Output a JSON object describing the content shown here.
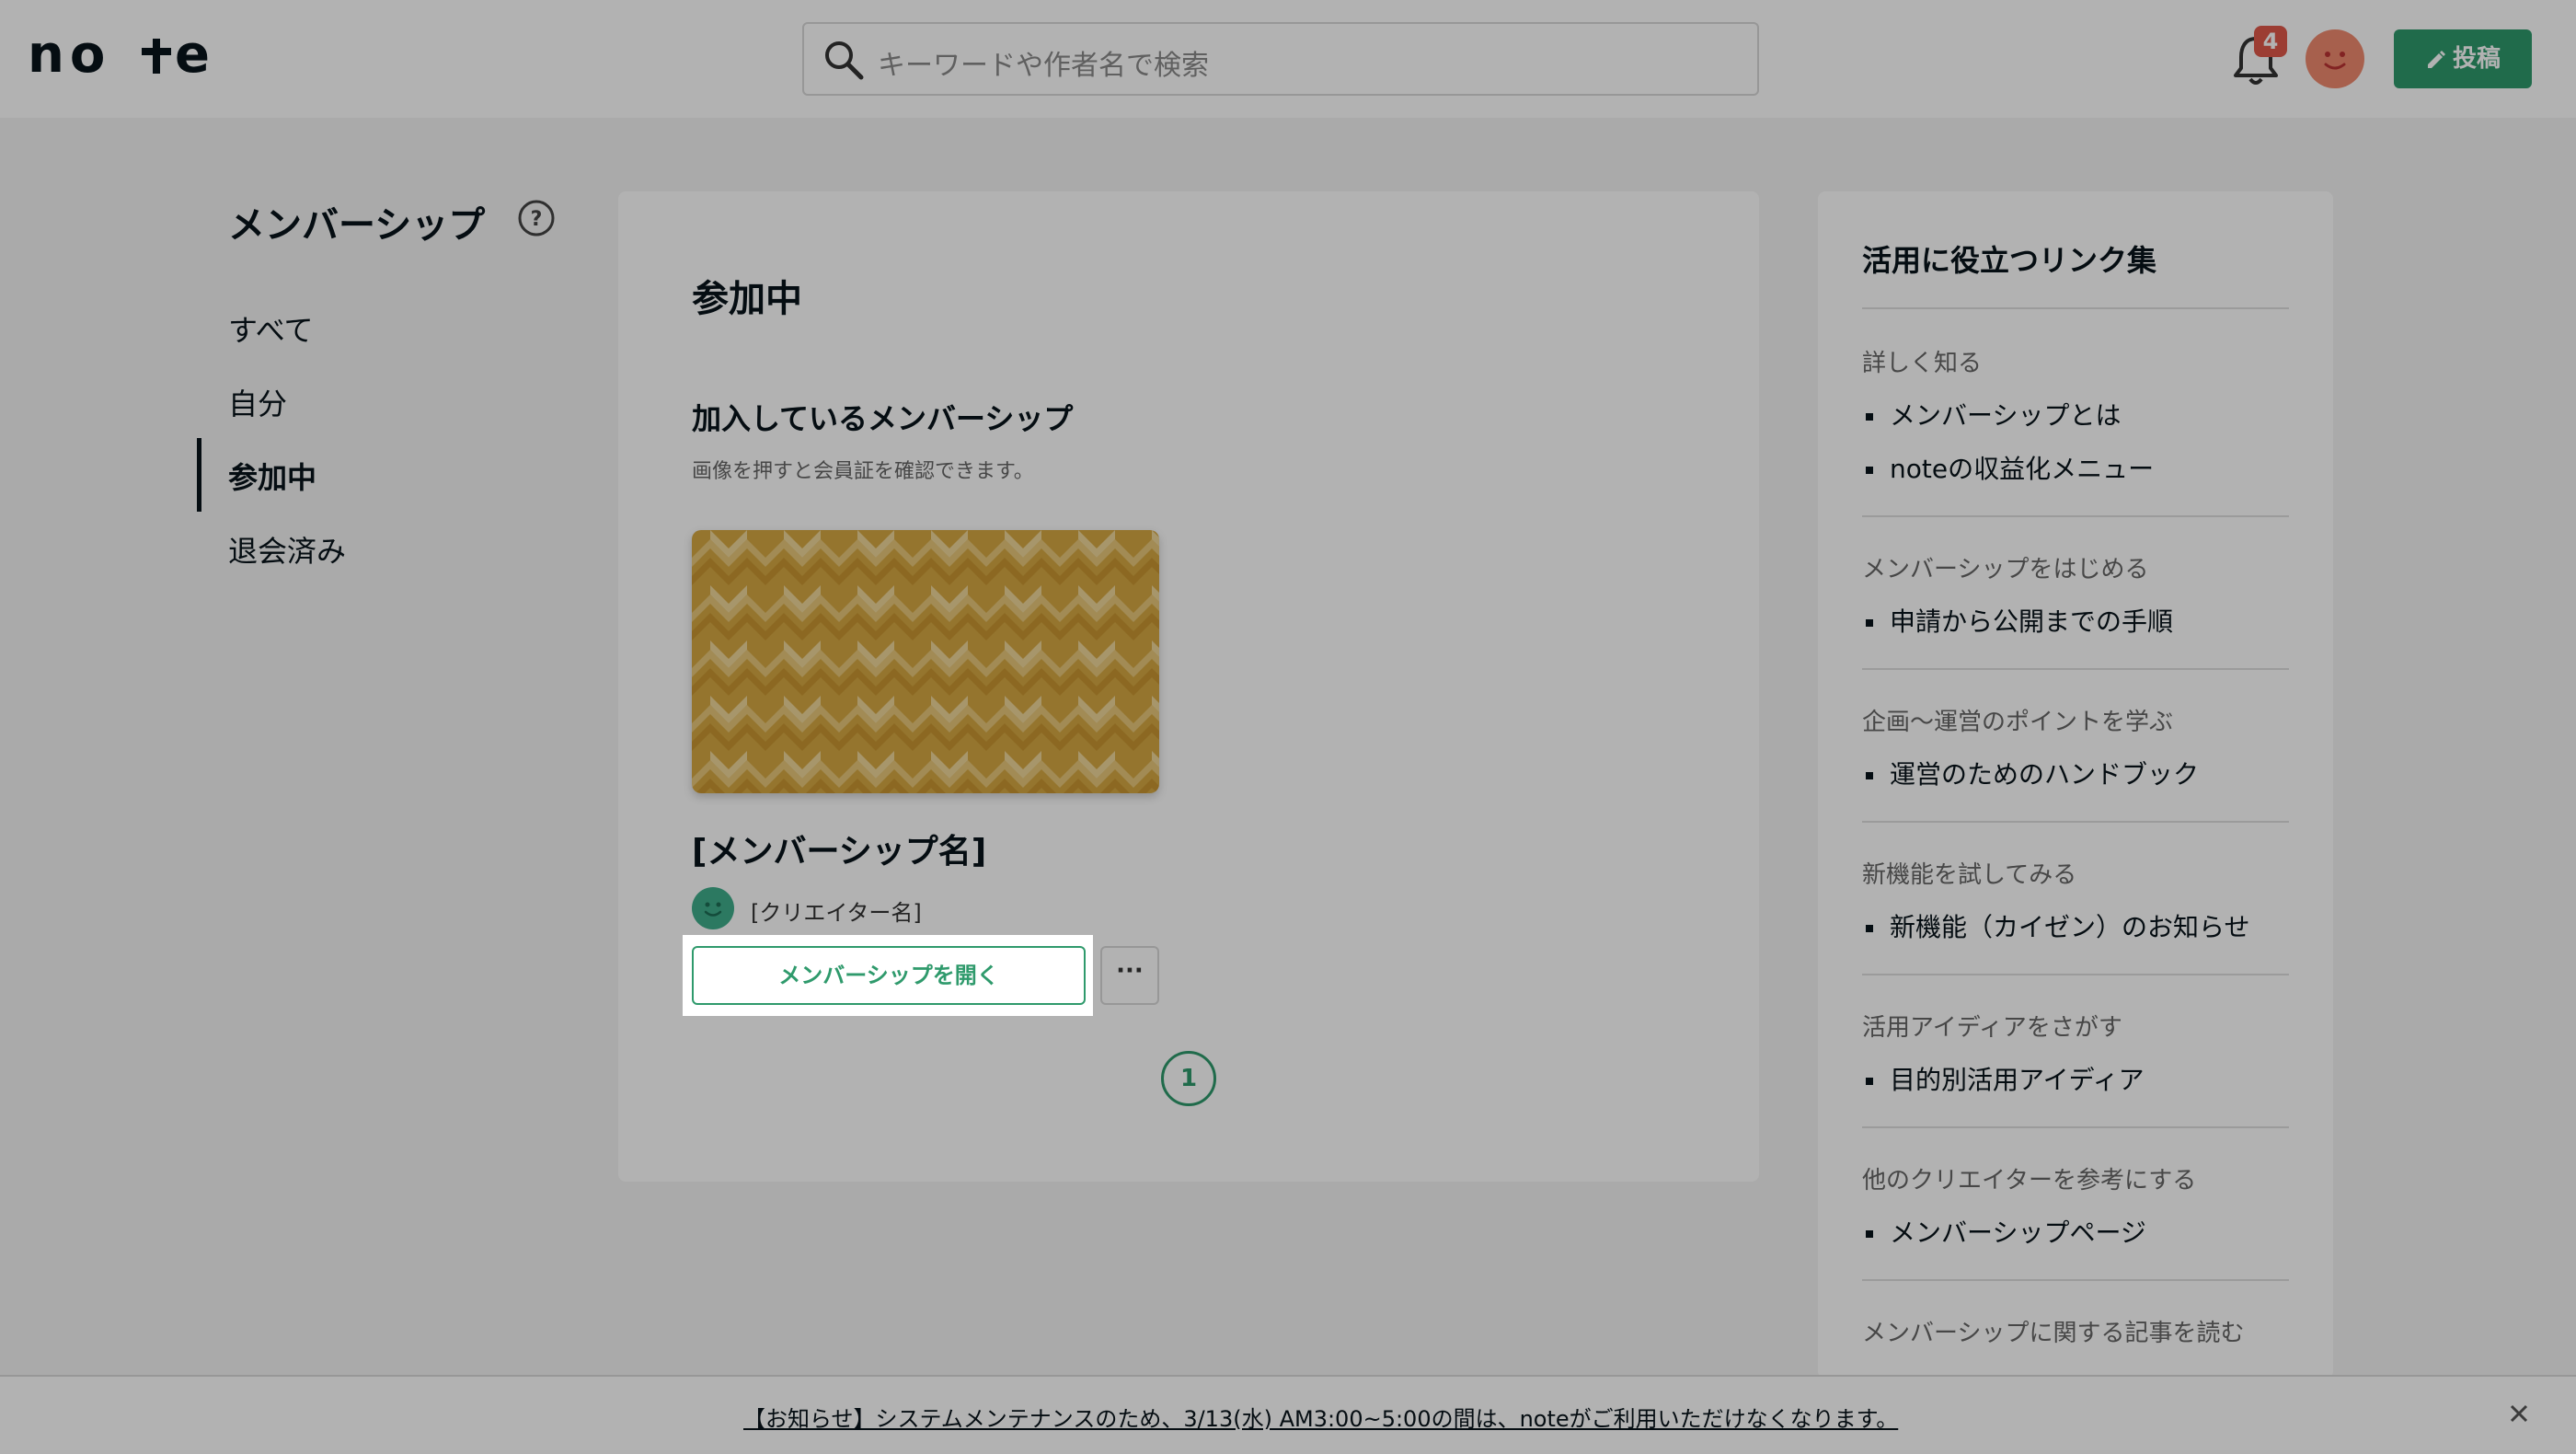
{
  "header": {
    "logo_text": "note",
    "search_placeholder": "キーワードや作者名で検索",
    "notification_count": "4",
    "post_label": "投稿"
  },
  "nav": {
    "title": "メンバーシップ",
    "items": [
      {
        "label": "すべて"
      },
      {
        "label": "自分"
      },
      {
        "label": "参加中",
        "active": true
      },
      {
        "label": "退会済み"
      }
    ]
  },
  "main": {
    "title": "参加中",
    "section_title": "加入しているメンバーシップ",
    "section_desc": "画像を押すと会員証を確認できます。",
    "membership_name": "[メンバーシップ名]",
    "creator_name": "[クリエイター名]",
    "open_button": "メンバーシップを開く",
    "more_button": "···",
    "page": "1"
  },
  "links": {
    "title": "活用に役立つリンク集",
    "groups": [
      {
        "category": "詳しく知る",
        "items": [
          "メンバーシップとは",
          "noteの収益化メニュー"
        ]
      },
      {
        "category": "メンバーシップをはじめる",
        "items": [
          "申請から公開までの手順"
        ]
      },
      {
        "category": "企画〜運営のポイントを学ぶ",
        "items": [
          "運営のためのハンドブック"
        ]
      },
      {
        "category": "新機能を試してみる",
        "items": [
          "新機能（カイゼン）のお知らせ"
        ]
      },
      {
        "category": "活用アイディアをさがす",
        "items": [
          "目的別活用アイディア"
        ]
      },
      {
        "category": "他のクリエイターを参考にする",
        "items": [
          "メンバーシップページ"
        ]
      },
      {
        "category": "メンバーシップに関する記事を読む",
        "items": []
      }
    ]
  },
  "notice": {
    "text": "【お知らせ】システムメンテナンスのため、3/13(水) AM3:00~5:00の間は、noteがご利用いただけなくなります。"
  },
  "colors": {
    "accent": "#2f9a6c",
    "badge": "#e0584a",
    "avatar": "#f08a6f",
    "creator_avatar": "#3fae8c",
    "card_pattern": "#d4a53a"
  }
}
